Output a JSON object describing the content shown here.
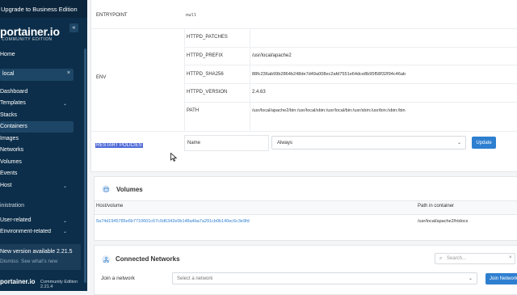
{
  "sidebar": {
    "upgrade_banner": "Upgrade to Business Edition",
    "logo": "portainer.io",
    "logo_sub": "COMMUNITY EDITION",
    "collapse_glyph": "«",
    "home": "Home",
    "environment": {
      "name": "local",
      "clear_glyph": "×"
    },
    "items": [
      {
        "label": "Dashboard"
      },
      {
        "label": "Templates"
      },
      {
        "label": "Stacks"
      },
      {
        "label": "Containers"
      },
      {
        "label": "Images"
      },
      {
        "label": "Networks"
      },
      {
        "label": "Volumes"
      },
      {
        "label": "Events"
      },
      {
        "label": "Host"
      }
    ],
    "administration": "inistration",
    "user_related": "User-related",
    "environment_related": "Environment-related",
    "new_version": "New version available 2.21.5",
    "dismiss": "Dismiss",
    "whats_new": "See what's new",
    "footer_logo": "portainer.io",
    "footer_edition": "Community Edition 2.21.4"
  },
  "config": {
    "entrypoint_key": "ENTRYPOINT",
    "entrypoint_val": "null",
    "env_key": "ENV",
    "env_rows": [
      {
        "key": "HTTPD_PATCHES",
        "value": ""
      },
      {
        "key": "HTTPD_PREFIX",
        "value": "/usr/local/apache2"
      },
      {
        "key": "HTTPD_SHA256",
        "value": "88fc236ab99b2864b248de7d49a008ec2afd7551e64dce8b95f58f32f94c46ab"
      },
      {
        "key": "HTTPD_VERSION",
        "value": "2.4.63"
      },
      {
        "key": "PATH",
        "value": "/usr/local/apache2/bin:/usr/local/sbin:/usr/local/bin:/usr/sbin:/usr/bin:/sbin:/bin"
      }
    ],
    "restart_key": "RESTART POLICIES",
    "restart_name_label": "Name",
    "restart_value": "Always",
    "update_label": "Update"
  },
  "volumes": {
    "title": "Volumes",
    "col_host": "Host/volume",
    "col_path": "Path in container",
    "rows": [
      {
        "host": "5a74d1945785e6b7710601c67c0d6342e0b148a4ba7a291cb0b140ec6c3e9fd",
        "path": "/usr/local/apache2/htdocs"
      }
    ]
  },
  "networks": {
    "title": "Connected Networks",
    "search_placeholder": "Search...",
    "join_label": "Join a network",
    "select_placeholder": "Select a network",
    "join_button": "Join Network"
  }
}
